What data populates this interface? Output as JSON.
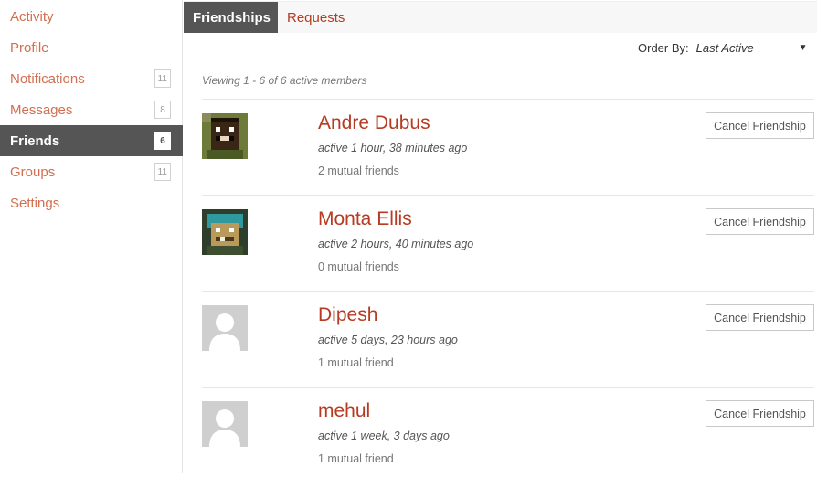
{
  "sidebar": {
    "items": [
      {
        "label": "Activity",
        "badge": ""
      },
      {
        "label": "Profile",
        "badge": ""
      },
      {
        "label": "Notifications",
        "badge": "11"
      },
      {
        "label": "Messages",
        "badge": "8"
      },
      {
        "label": "Friends",
        "badge": "6",
        "active": true
      },
      {
        "label": "Groups",
        "badge": "11"
      },
      {
        "label": "Settings",
        "badge": ""
      }
    ]
  },
  "tabs": [
    {
      "label": "Friendships",
      "active": true
    },
    {
      "label": "Requests",
      "active": false
    }
  ],
  "order_by": {
    "label": "Order By:",
    "value": "Last Active"
  },
  "viewing_text": "Viewing 1 - 6 of 6 active members",
  "members": [
    {
      "name": "Andre Dubus",
      "active": "active 1 hour, 38 minutes ago",
      "mutual": "2 mutual friends",
      "action": "Cancel Friendship",
      "avatar": "pixel-avatar-dark-icon"
    },
    {
      "name": "Monta Ellis",
      "active": "active 2 hours, 40 minutes ago",
      "mutual": "0 mutual friends",
      "action": "Cancel Friendship",
      "avatar": "pixel-avatar-teal-icon"
    },
    {
      "name": "Dipesh",
      "active": "active 5 days, 23 hours ago",
      "mutual": "1 mutual friend",
      "action": "Cancel Friendship",
      "avatar": "default-user-icon"
    },
    {
      "name": "mehul",
      "active": "active 1 week, 3 days ago",
      "mutual": "1 mutual friend",
      "action": "Cancel Friendship",
      "avatar": "default-user-icon"
    }
  ],
  "colors": {
    "accent": "#b53b22",
    "sidebar_link": "#d26f50",
    "active_bg": "#555555"
  }
}
